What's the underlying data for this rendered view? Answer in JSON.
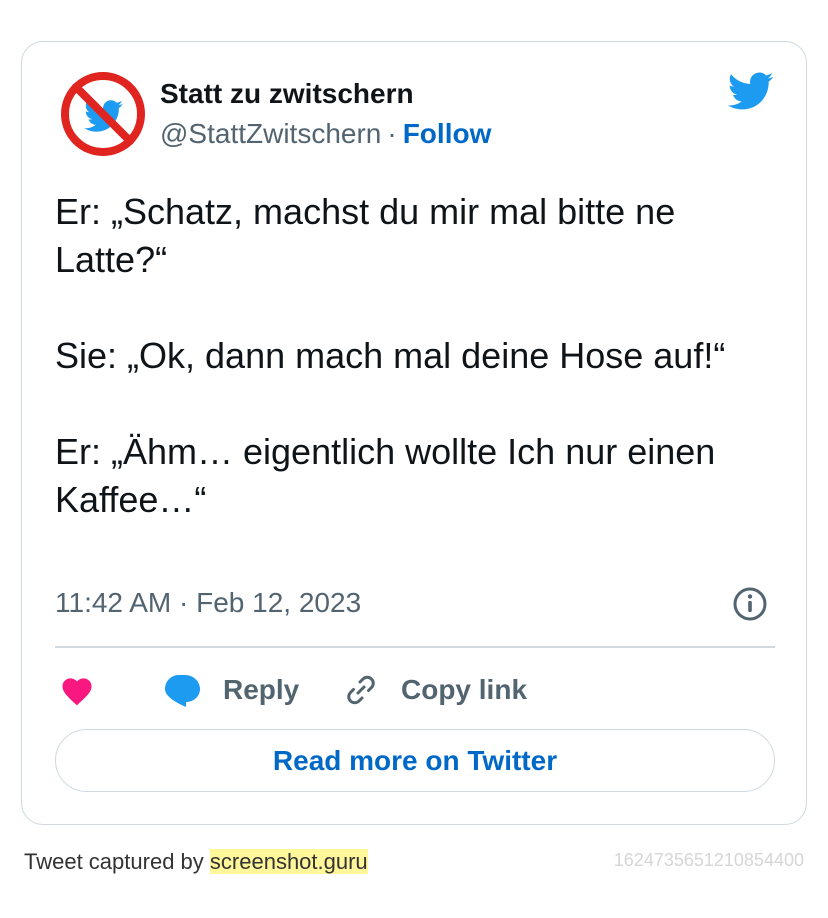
{
  "author": {
    "name": "Statt zu zwitschern",
    "handle": "@StattZwitschern",
    "separator": "·",
    "follow_label": "Follow"
  },
  "tweet": {
    "paragraphs": [
      "Er: „Schatz, machst du mir mal bitte ne Latte?“",
      "Sie: „Ok, dann mach mal deine Hose auf!“",
      "Er: „Ähm… eigentlich wollte Ich nur einen Kaffee…“"
    ],
    "time": "11:42 AM",
    "separator": "·",
    "date": "Feb 12, 2023"
  },
  "actions": {
    "like_icon": "heart-icon",
    "reply_label": "Reply",
    "copy_link_label": "Copy link"
  },
  "read_more_label": "Read more on Twitter",
  "footer": {
    "prefix": "Tweet captured by",
    "link_text": "screenshot.guru",
    "tweet_id": "1624735651210854400"
  },
  "colors": {
    "link_blue": "#0069c7",
    "twitter_blue": "#1d9bf0",
    "like_pink": "#f91880",
    "muted_gray": "#536471",
    "border": "#cfd9de",
    "no_sign_red": "#e0241f",
    "highlight": "#fff79a"
  }
}
